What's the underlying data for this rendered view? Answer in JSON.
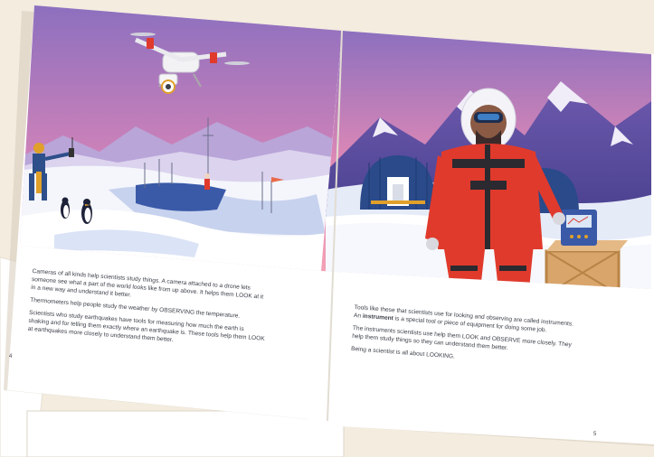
{
  "book": {
    "left_page": {
      "paragraphs": [
        "Cameras of all kinds help scientists study things. A camera attached to a drone lets someone see what a part of the world looks like from up above. It helps them LOOK at it in a new way and understand it better.",
        "Thermometers help people study the weather by OBSERVING the temperature.",
        "Scientists who study earthquakes have tools for measuring how much the earth is shaking and for telling them exactly where an earthquake is. These tools help them LOOK at earthquakes more closely to understand them better."
      ],
      "page_number": "4"
    },
    "right_page": {
      "paragraph1_before": "Tools like these that scientists use for looking and observing are called instruments. An ",
      "paragraph1_bold": "instrument",
      "paragraph1_after": " is a special tool or piece of equipment for doing some job.",
      "paragraph2": "The instruments scientists use help them LOOK and OBSERVE more closely. They help them study things so they can understand them better.",
      "paragraph3": "Being a scientist is all about LOOKING.",
      "page_number": "5"
    }
  },
  "colors": {
    "sky_top": "#8a6fbf",
    "sky_bottom": "#f08bb0",
    "snow": "#ffffff",
    "snow_shadow": "#c9d4ee",
    "mountain_dark": "#5a4a9a",
    "suit_red": "#e03a2c",
    "hut_blue": "#2a4a8a",
    "crate": "#d9a56b",
    "background": "#f3ecdf"
  },
  "icons": [
    "drone-icon",
    "penguin-icon",
    "thermometer-flag-icon",
    "radio-device-icon"
  ]
}
